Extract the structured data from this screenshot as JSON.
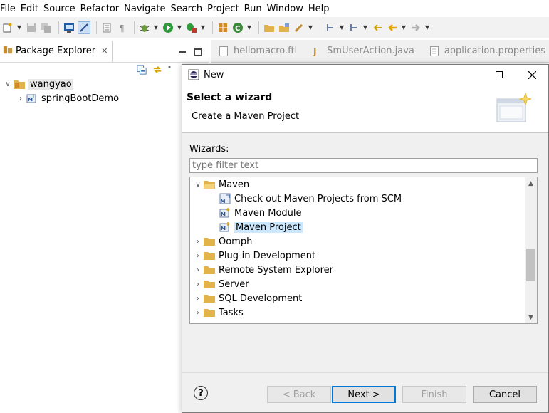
{
  "menu": [
    "File",
    "Edit",
    "Source",
    "Refactor",
    "Navigate",
    "Search",
    "Project",
    "Run",
    "Window",
    "Help"
  ],
  "explorer": {
    "tab_label": "Package Explorer",
    "tree": [
      {
        "label": "wangyao",
        "expanded": true
      },
      {
        "label": "springBootDemo",
        "expanded": false
      }
    ]
  },
  "editor_tabs": [
    "hellomacro.ftl",
    "SmUserAction.java",
    "application.properties"
  ],
  "dialog": {
    "title": "New",
    "header_title": "Select a wizard",
    "header_subtitle": "Create a Maven Project",
    "wizards_label": "Wizards:",
    "filter_placeholder": "type filter text",
    "tree": [
      {
        "label": "Maven",
        "level": 0,
        "expanded": true,
        "icon": "folder-open-icon"
      },
      {
        "label": "Check out Maven Projects from SCM",
        "level": 1,
        "icon": "maven-scm-icon"
      },
      {
        "label": "Maven Module",
        "level": 1,
        "icon": "maven-module-icon"
      },
      {
        "label": "Maven Project",
        "level": 1,
        "icon": "maven-project-icon",
        "selected": true
      },
      {
        "label": "Oomph",
        "level": 0,
        "icon": "folder-icon"
      },
      {
        "label": "Plug-in Development",
        "level": 0,
        "icon": "folder-icon"
      },
      {
        "label": "Remote System Explorer",
        "level": 0,
        "icon": "folder-icon"
      },
      {
        "label": "Server",
        "level": 0,
        "icon": "folder-icon"
      },
      {
        "label": "SQL Development",
        "level": 0,
        "icon": "folder-icon"
      },
      {
        "label": "Tasks",
        "level": 0,
        "icon": "folder-icon"
      }
    ],
    "buttons": {
      "back": "< Back",
      "next": "Next >",
      "finish": "Finish",
      "cancel": "Cancel"
    },
    "help_symbol": "?"
  },
  "colors": {
    "selection": "#cce8ff",
    "default_button_border": "#0078d7"
  }
}
